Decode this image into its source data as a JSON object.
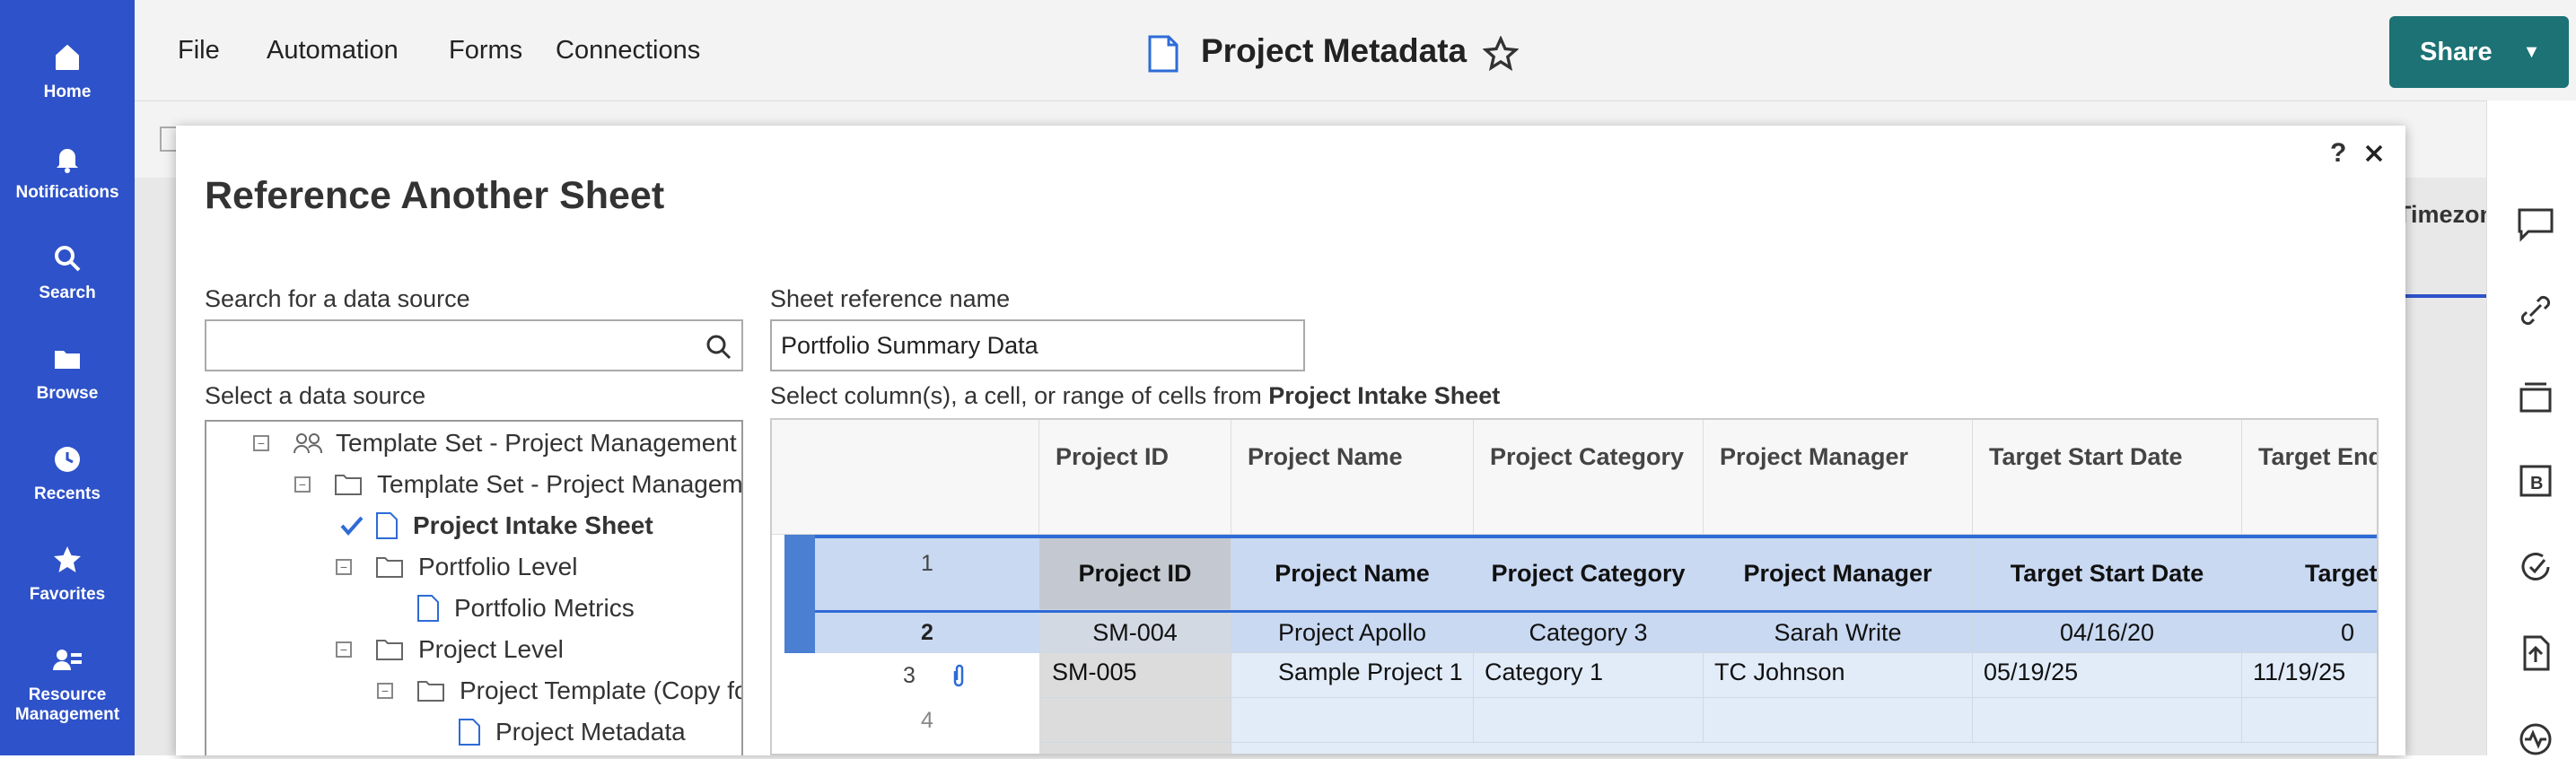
{
  "nav": {
    "items": [
      {
        "label": "Home",
        "icon": "home-icon"
      },
      {
        "label": "Notifications",
        "icon": "bell-icon"
      },
      {
        "label": "Search",
        "icon": "search-icon"
      },
      {
        "label": "Browse",
        "icon": "folder-icon"
      },
      {
        "label": "Recents",
        "icon": "clock-icon"
      },
      {
        "label": "Favorites",
        "icon": "star-icon"
      },
      {
        "label": "Resource",
        "label2": "Management",
        "icon": "people-icon"
      }
    ]
  },
  "menu": {
    "file": "File",
    "automation": "Automation",
    "forms": "Forms",
    "connections": "Connections"
  },
  "header": {
    "title": "Project Metadata",
    "share": "Share"
  },
  "background": {
    "col_header": "Timezone"
  },
  "modal": {
    "title": "Reference Another Sheet",
    "help": "?",
    "search_label": "Search for a data source",
    "search_value": "",
    "select_label": "Select a data source",
    "ref_label": "Sheet reference name",
    "ref_value": "Portfolio Summary Data",
    "select_cols_prefix": "Select column(s), a cell, or range of cells from ",
    "select_cols_sheet": "Project Intake Sheet"
  },
  "tree": [
    "Template Set - Project Management Office",
    "Template Set - Project Management",
    "Project Intake Sheet",
    "Portfolio Level",
    "Portfolio Metrics",
    "Project Level",
    "Project Template (Copy for each project)",
    "Project Metadata"
  ],
  "grid": {
    "headers": [
      "Project ID",
      "Project Name",
      "Project Category",
      "Project Manager",
      "Target Start Date",
      "Target End Date"
    ],
    "rows": [
      {
        "num": "1",
        "cells": [
          "Project ID",
          "Project Name",
          "Project Category",
          "Project Manager",
          "Target Start Date",
          "Target End Date"
        ]
      },
      {
        "num": "2",
        "cells": [
          "SM-004",
          "Project Apollo",
          "Category 3",
          "Sarah Write",
          "04/16/20",
          "0"
        ]
      },
      {
        "num": "3",
        "cells": [
          "SM-005",
          "Sample Project 1",
          "Category 1",
          "TC Johnson",
          "05/19/25",
          "11/19/25"
        ]
      },
      {
        "num": "4",
        "cells": [
          "",
          "",
          "",
          "",
          "",
          ""
        ]
      }
    ]
  },
  "colors": {
    "nav": "#2e52c9",
    "share": "#1c7274",
    "selection": "#c9d9f2",
    "selection_border": "#2e6bd6"
  }
}
